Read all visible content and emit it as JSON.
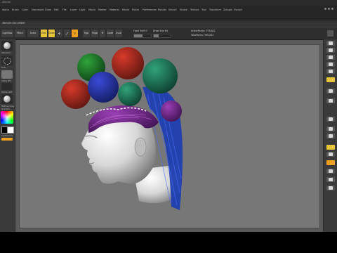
{
  "app": {
    "title": "ZBrush",
    "document_label": "ZBRUSH DOCUMENT"
  },
  "menu": {
    "items": [
      "Alpha",
      "Brush",
      "Color",
      "Document",
      "Draw",
      "Edit",
      "File",
      "Layer",
      "Light",
      "Macro",
      "Marker",
      "Material",
      "Movie",
      "Picker",
      "Preferences",
      "Render",
      "Stencil",
      "Stroke",
      "Texture",
      "Tool",
      "Transform",
      "Zplugin",
      "Zscript"
    ]
  },
  "shelf": {
    "move_label": "Move",
    "scale_label": "Scale",
    "rotate_label": "Rotate",
    "lightbox_label": "LightBox",
    "edit_label": "Edit",
    "draw_label": "Draw",
    "rgb_label": "Rgb",
    "m_label": "M",
    "mrgb_label": "Mrgb",
    "zadd_label": "Zadd",
    "zsub_label": "Zsub",
    "focal_shift_label": "Focal Shift 0",
    "draw_size_label": "Draw Size 64",
    "active_points_label": "ActivePoints: 378,842",
    "total_points_label": "TotalPoints: 390,053"
  },
  "left_panel": {
    "brush_name": "Standard",
    "stroke_name": "Dots",
    "alpha_name": "Alpha Off",
    "texture_name": "Texture Off",
    "material_name": "MatCap Gray",
    "gradient_label": "Gradient",
    "switch_color_label": "SwitchColor"
  },
  "colors": {
    "accent_orange": "#f0a020",
    "accent_yellow": "#e7c53b",
    "canvas_bg": "#777777",
    "ui_dark": "#2e2e2e"
  },
  "icons": [
    "brush-icon",
    "stroke-icon",
    "alpha-icon",
    "material-icon",
    "color-picker-icon",
    "bpr-icon",
    "spix-icon",
    "scroll-icon",
    "zoom-icon",
    "actual-icon",
    "aahalf-icon",
    "persp-icon",
    "floor-icon",
    "local-icon",
    "frame-icon",
    "move-icon",
    "scale-icon",
    "rotate-icon",
    "polyf-icon",
    "transp-icon",
    "solo-icon",
    "xpose-icon"
  ]
}
